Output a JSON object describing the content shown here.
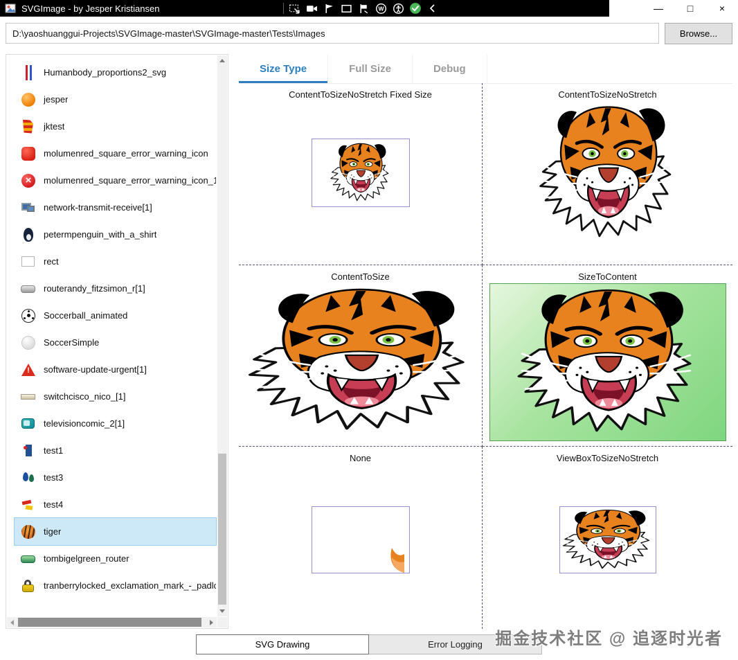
{
  "window": {
    "title": "SVGImage - by Jesper Kristiansen",
    "controls": {
      "minimize": "—",
      "maximize": "□",
      "close": "×"
    }
  },
  "titlebar_toolbar": {
    "icons": [
      "capture-region",
      "video-record",
      "flag-marker",
      "rectangle-select",
      "flag-pin",
      "word-circle",
      "accessibility",
      "check-success",
      "collapse-left"
    ]
  },
  "address_bar": {
    "path": "D:\\yaoshuanggui-Projects\\SVGImage-master\\SVGImage-master\\Tests\\Images",
    "browse_label": "Browse..."
  },
  "sidebar": {
    "items": [
      {
        "label": "Humanbody_proportions2_svg",
        "icon": "human-body-icon",
        "selected": false
      },
      {
        "label": "jesper",
        "icon": "orange-sphere-icon",
        "selected": false
      },
      {
        "label": "jktest",
        "icon": "color-blocks-icon",
        "selected": false
      },
      {
        "label": "molumenred_square_error_warning_icon",
        "icon": "red-square-icon",
        "selected": false
      },
      {
        "label": "molumenred_square_error_warning_icon_1",
        "icon": "red-error-circle-icon",
        "selected": false
      },
      {
        "label": "network-transmit-receive[1]",
        "icon": "network-monitors-icon",
        "selected": false
      },
      {
        "label": "petermpenguin_with_a_shirt",
        "icon": "penguin-icon",
        "selected": false
      },
      {
        "label": "rect",
        "icon": "rectangle-icon",
        "selected": false
      },
      {
        "label": "routerandy_fitzsimon_r[1]",
        "icon": "router-grey-icon",
        "selected": false
      },
      {
        "label": "Soccerball_animated",
        "icon": "soccer-ball-icon",
        "selected": false
      },
      {
        "label": "SoccerSimple",
        "icon": "white-sphere-icon",
        "selected": false
      },
      {
        "label": "software-update-urgent[1]",
        "icon": "warning-triangle-icon",
        "selected": false
      },
      {
        "label": "switchcisco_nico_[1]",
        "icon": "switch-icon",
        "selected": false
      },
      {
        "label": "televisioncomic_2[1]",
        "icon": "television-icon",
        "selected": false
      },
      {
        "label": "test1",
        "icon": "test1-icon",
        "selected": false
      },
      {
        "label": "test3",
        "icon": "test3-icon",
        "selected": false
      },
      {
        "label": "test4",
        "icon": "test4-icon",
        "selected": false
      },
      {
        "label": "tiger",
        "icon": "tiger-icon",
        "selected": true
      },
      {
        "label": "tombigelgreen_router",
        "icon": "router-green-icon",
        "selected": false
      },
      {
        "label": "tranberrylocked_exclamation_mark_-_padlc",
        "icon": "padlock-icon",
        "selected": false
      }
    ]
  },
  "main": {
    "tabs": [
      {
        "label": "Size Type",
        "active": true
      },
      {
        "label": "Full Size",
        "active": false
      },
      {
        "label": "Debug",
        "active": false
      }
    ],
    "cells": [
      {
        "title": "ContentToSizeNoStretch Fixed Size"
      },
      {
        "title": "ContentToSizeNoStretch"
      },
      {
        "title": "ContentToSize"
      },
      {
        "title": "SizeToContent"
      },
      {
        "title": "None"
      },
      {
        "title": "ViewBoxToSizeNoStretch"
      }
    ]
  },
  "bottom_tabs": [
    {
      "label": "SVG Drawing",
      "active": true
    },
    {
      "label": "Error Logging",
      "active": false
    }
  ],
  "watermark": "掘金技术社区 @ 追逐时光者",
  "colors": {
    "accent": "#2d7fc1",
    "selection": "#cde9f7",
    "green_box": "#7fd67f",
    "image_box_border": "#9a8fd0",
    "titlebar": "#000000",
    "check_success": "#49b65a"
  }
}
